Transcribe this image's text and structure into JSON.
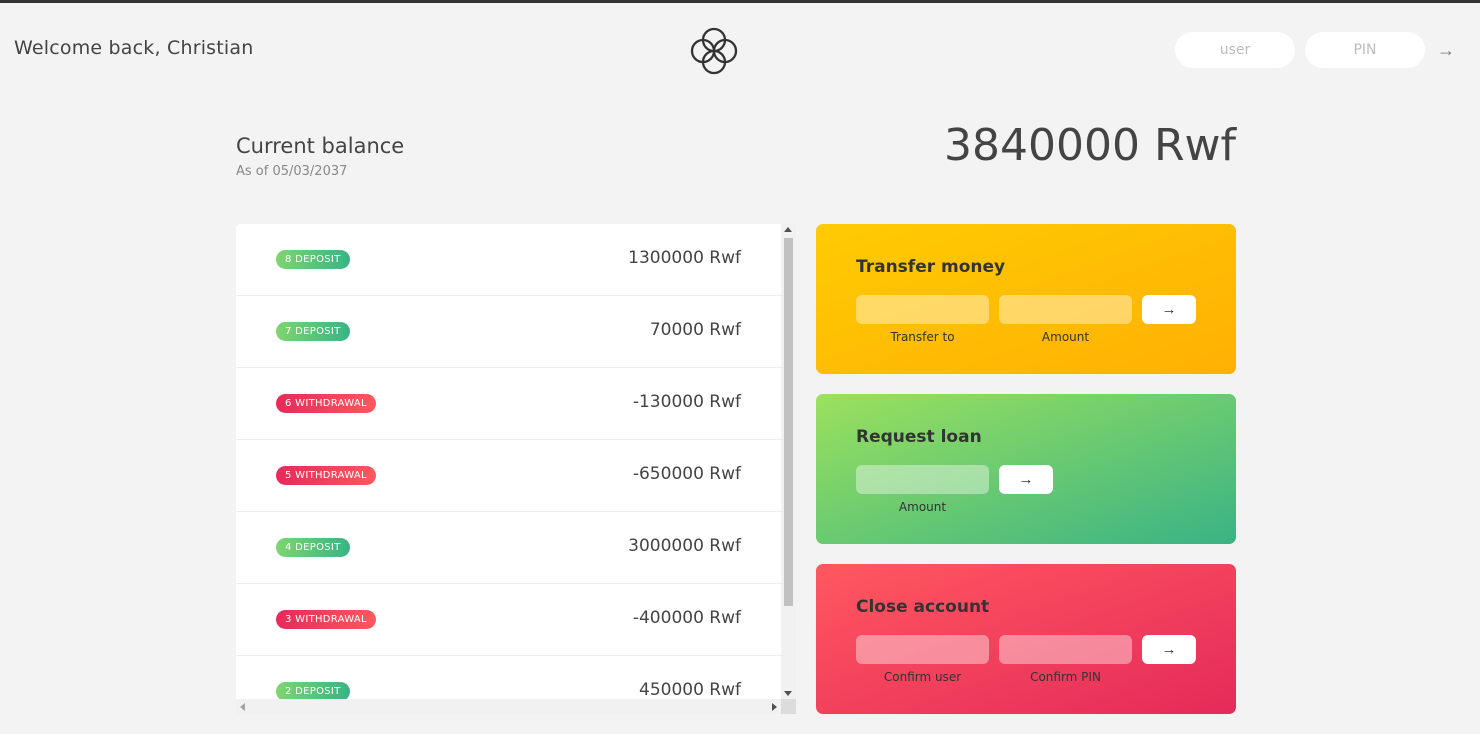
{
  "nav": {
    "welcome": "Welcome back, Christian",
    "logo_icon": "four-rings-logo-icon",
    "user_placeholder": "user",
    "pin_placeholder": "PIN",
    "login_button": "→"
  },
  "balance": {
    "label": "Current balance",
    "date": "As of 05/03/2037",
    "value": "3840000 Rwf"
  },
  "movements": [
    {
      "type_label": "8 deposit",
      "kind": "deposit",
      "value": "1300000 Rwf"
    },
    {
      "type_label": "7 deposit",
      "kind": "deposit",
      "value": "70000 Rwf"
    },
    {
      "type_label": "6 withdrawal",
      "kind": "withdrawal",
      "value": "-130000 Rwf"
    },
    {
      "type_label": "5 withdrawal",
      "kind": "withdrawal",
      "value": "-650000 Rwf"
    },
    {
      "type_label": "4 deposit",
      "kind": "deposit",
      "value": "3000000 Rwf"
    },
    {
      "type_label": "3 withdrawal",
      "kind": "withdrawal",
      "value": "-400000 Rwf"
    },
    {
      "type_label": "2 deposit",
      "kind": "deposit",
      "value": "450000 Rwf"
    }
  ],
  "operations": {
    "transfer": {
      "title": "Transfer money",
      "label_to": "Transfer to",
      "label_amount": "Amount",
      "button": "→"
    },
    "loan": {
      "title": "Request loan",
      "label_amount": "Amount",
      "button": "→"
    },
    "close": {
      "title": "Close account",
      "label_user": "Confirm user",
      "label_pin": "Confirm PIN",
      "button": "→"
    }
  },
  "colors": {
    "deposit": "#39b385",
    "withdrawal": "#e52a5a",
    "transfer": "#ffb003",
    "loan": "#9be15d",
    "close": "#ff585f"
  }
}
